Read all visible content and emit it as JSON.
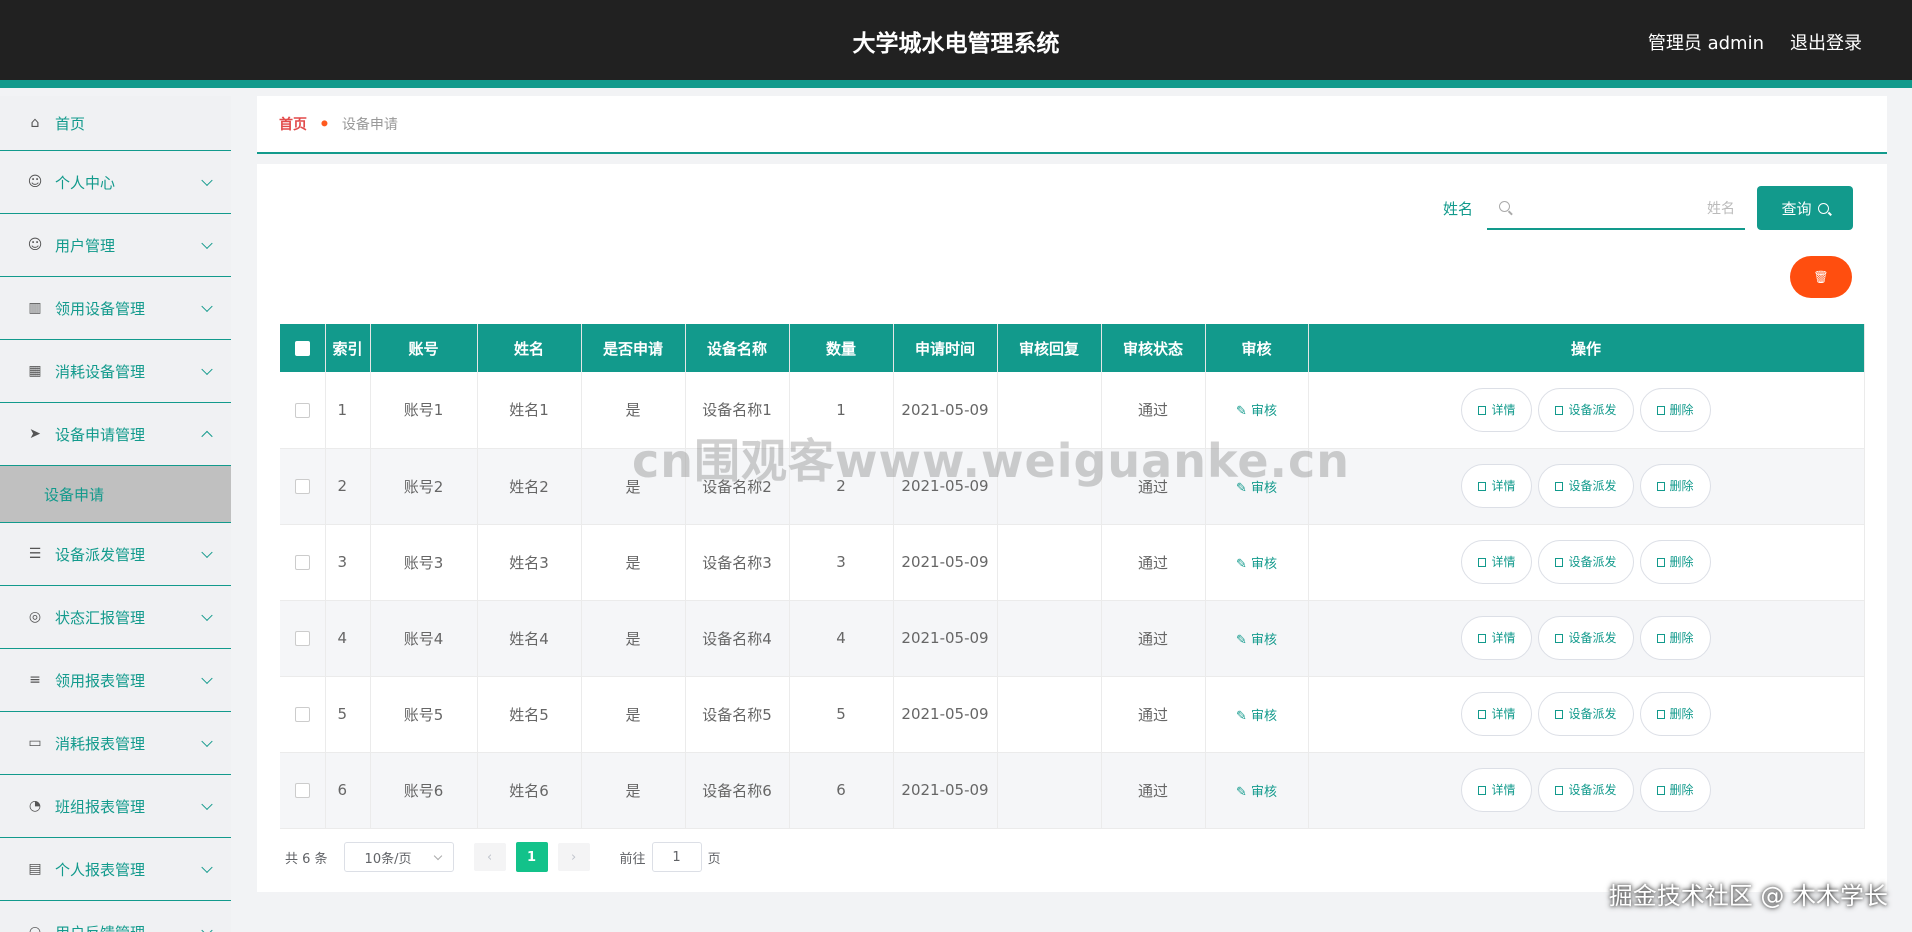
{
  "header": {
    "title": "大学城水电管理系统",
    "user_label": "管理员 admin",
    "logout_label": "退出登录"
  },
  "sidebar": {
    "items": [
      {
        "label": "首页",
        "icon": "home-icon",
        "arrow": false
      },
      {
        "label": "个人中心",
        "icon": "user-icon",
        "arrow": true
      },
      {
        "label": "用户管理",
        "icon": "user-icon",
        "arrow": true
      },
      {
        "label": "领用设备管理",
        "icon": "book-icon",
        "arrow": true
      },
      {
        "label": "消耗设备管理",
        "icon": "grid-icon",
        "arrow": true
      },
      {
        "label": "设备申请管理",
        "icon": "send-icon",
        "arrow": true,
        "expanded": true
      },
      {
        "label": "设备派发管理",
        "icon": "list-icon",
        "arrow": true
      },
      {
        "label": "状态汇报管理",
        "icon": "target-icon",
        "arrow": true
      },
      {
        "label": "领用报表管理",
        "icon": "sliders-icon",
        "arrow": true
      },
      {
        "label": "消耗报表管理",
        "icon": "monitor-icon",
        "arrow": true
      },
      {
        "label": "班组报表管理",
        "icon": "compass-icon",
        "arrow": true
      },
      {
        "label": "个人报表管理",
        "icon": "clipboard-icon",
        "arrow": true
      },
      {
        "label": "用户反馈管理",
        "icon": "help-icon",
        "arrow": true
      }
    ],
    "submenu": {
      "label": "设备申请"
    }
  },
  "breadcrumb": {
    "home": "首页",
    "current": "设备申请"
  },
  "search": {
    "label": "姓名",
    "placeholder": "姓名",
    "value": "",
    "button_label": "查询"
  },
  "table": {
    "headers": [
      "索引",
      "账号",
      "姓名",
      "是否申请",
      "设备名称",
      "数量",
      "申请时间",
      "审核回复",
      "审核状态",
      "审核",
      "操作"
    ],
    "rows": [
      {
        "index": "1",
        "account": "账号1",
        "name": "姓名1",
        "applied": "是",
        "device": "设备名称1",
        "qty": "1",
        "date": "2021-05-09",
        "reply": "",
        "status": "通过"
      },
      {
        "index": "2",
        "account": "账号2",
        "name": "姓名2",
        "applied": "是",
        "device": "设备名称2",
        "qty": "2",
        "date": "2021-05-09",
        "reply": "",
        "status": "通过"
      },
      {
        "index": "3",
        "account": "账号3",
        "name": "姓名3",
        "applied": "是",
        "device": "设备名称3",
        "qty": "3",
        "date": "2021-05-09",
        "reply": "",
        "status": "通过"
      },
      {
        "index": "4",
        "account": "账号4",
        "name": "姓名4",
        "applied": "是",
        "device": "设备名称4",
        "qty": "4",
        "date": "2021-05-09",
        "reply": "",
        "status": "通过"
      },
      {
        "index": "5",
        "account": "账号5",
        "name": "姓名5",
        "applied": "是",
        "device": "设备名称5",
        "qty": "5",
        "date": "2021-05-09",
        "reply": "",
        "status": "通过"
      },
      {
        "index": "6",
        "account": "账号6",
        "name": "姓名6",
        "applied": "是",
        "device": "设备名称6",
        "qty": "6",
        "date": "2021-05-09",
        "reply": "",
        "status": "通过"
      }
    ],
    "audit_label": "审核",
    "actions": {
      "detail": "详情",
      "dispatch": "设备派发",
      "delete": "删除"
    }
  },
  "pagination": {
    "total_text": "共 6 条",
    "page_size": "10条/页",
    "current_page": "1",
    "goto_prefix": "前往",
    "goto_value": "1",
    "goto_suffix": "页"
  },
  "watermarks": {
    "center": "cn围观客www.weiguanke.cn",
    "corner": "掘金技术社区 @ 木木学长"
  },
  "colors": {
    "accent": "#129a8c",
    "header_bg": "#212121",
    "danger": "#ff4e0f",
    "page_active": "#13c28a"
  }
}
